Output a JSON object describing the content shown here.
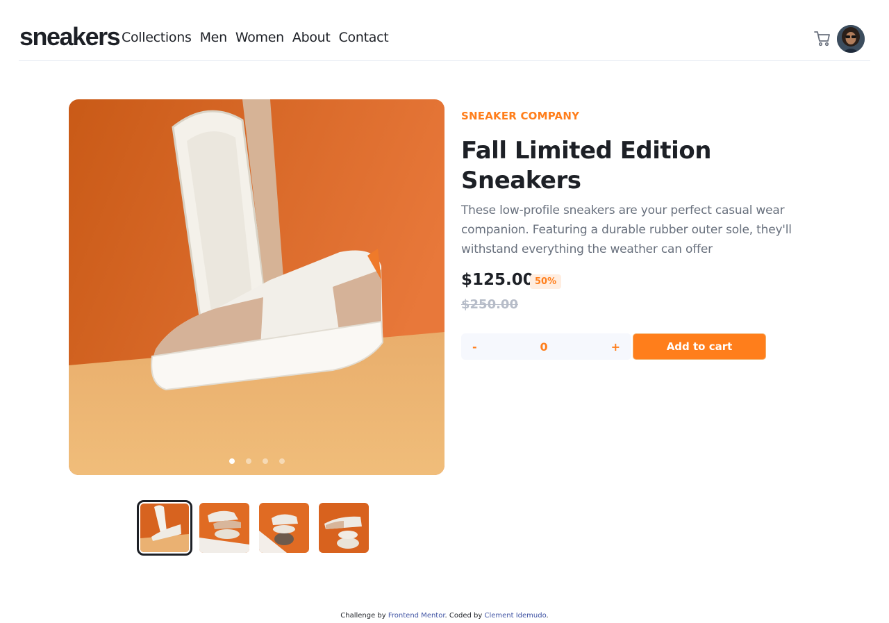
{
  "header": {
    "logo": "sneakers",
    "nav": [
      "Collections",
      "Men",
      "Women",
      "About",
      "Contact"
    ],
    "cart_icon": "cart-icon",
    "avatar": "user-avatar"
  },
  "gallery": {
    "active_index": 0,
    "slide_count": 4
  },
  "product": {
    "company": "SNEAKER COMPANY",
    "title": "Fall Limited Edition Sneakers",
    "description": "These low-profile sneakers are your perfect casual wear companion. Featuring a durable rubber outer sole, they'll withstand everything the weather can offer",
    "price": "$125.00",
    "discount": "50%",
    "old_price": "$250.00",
    "quantity": "0",
    "minus": "-",
    "plus": "+",
    "add_to_cart": "Add to cart"
  },
  "footer": {
    "prefix": "Challenge by ",
    "link1": "Frontend Mentor",
    "middle": ". Coded by ",
    "link2": "Clement Idemudo",
    "suffix": "."
  },
  "colors": {
    "accent": "#ff7e1b",
    "dark": "#1d2026",
    "gray": "#68707d"
  }
}
